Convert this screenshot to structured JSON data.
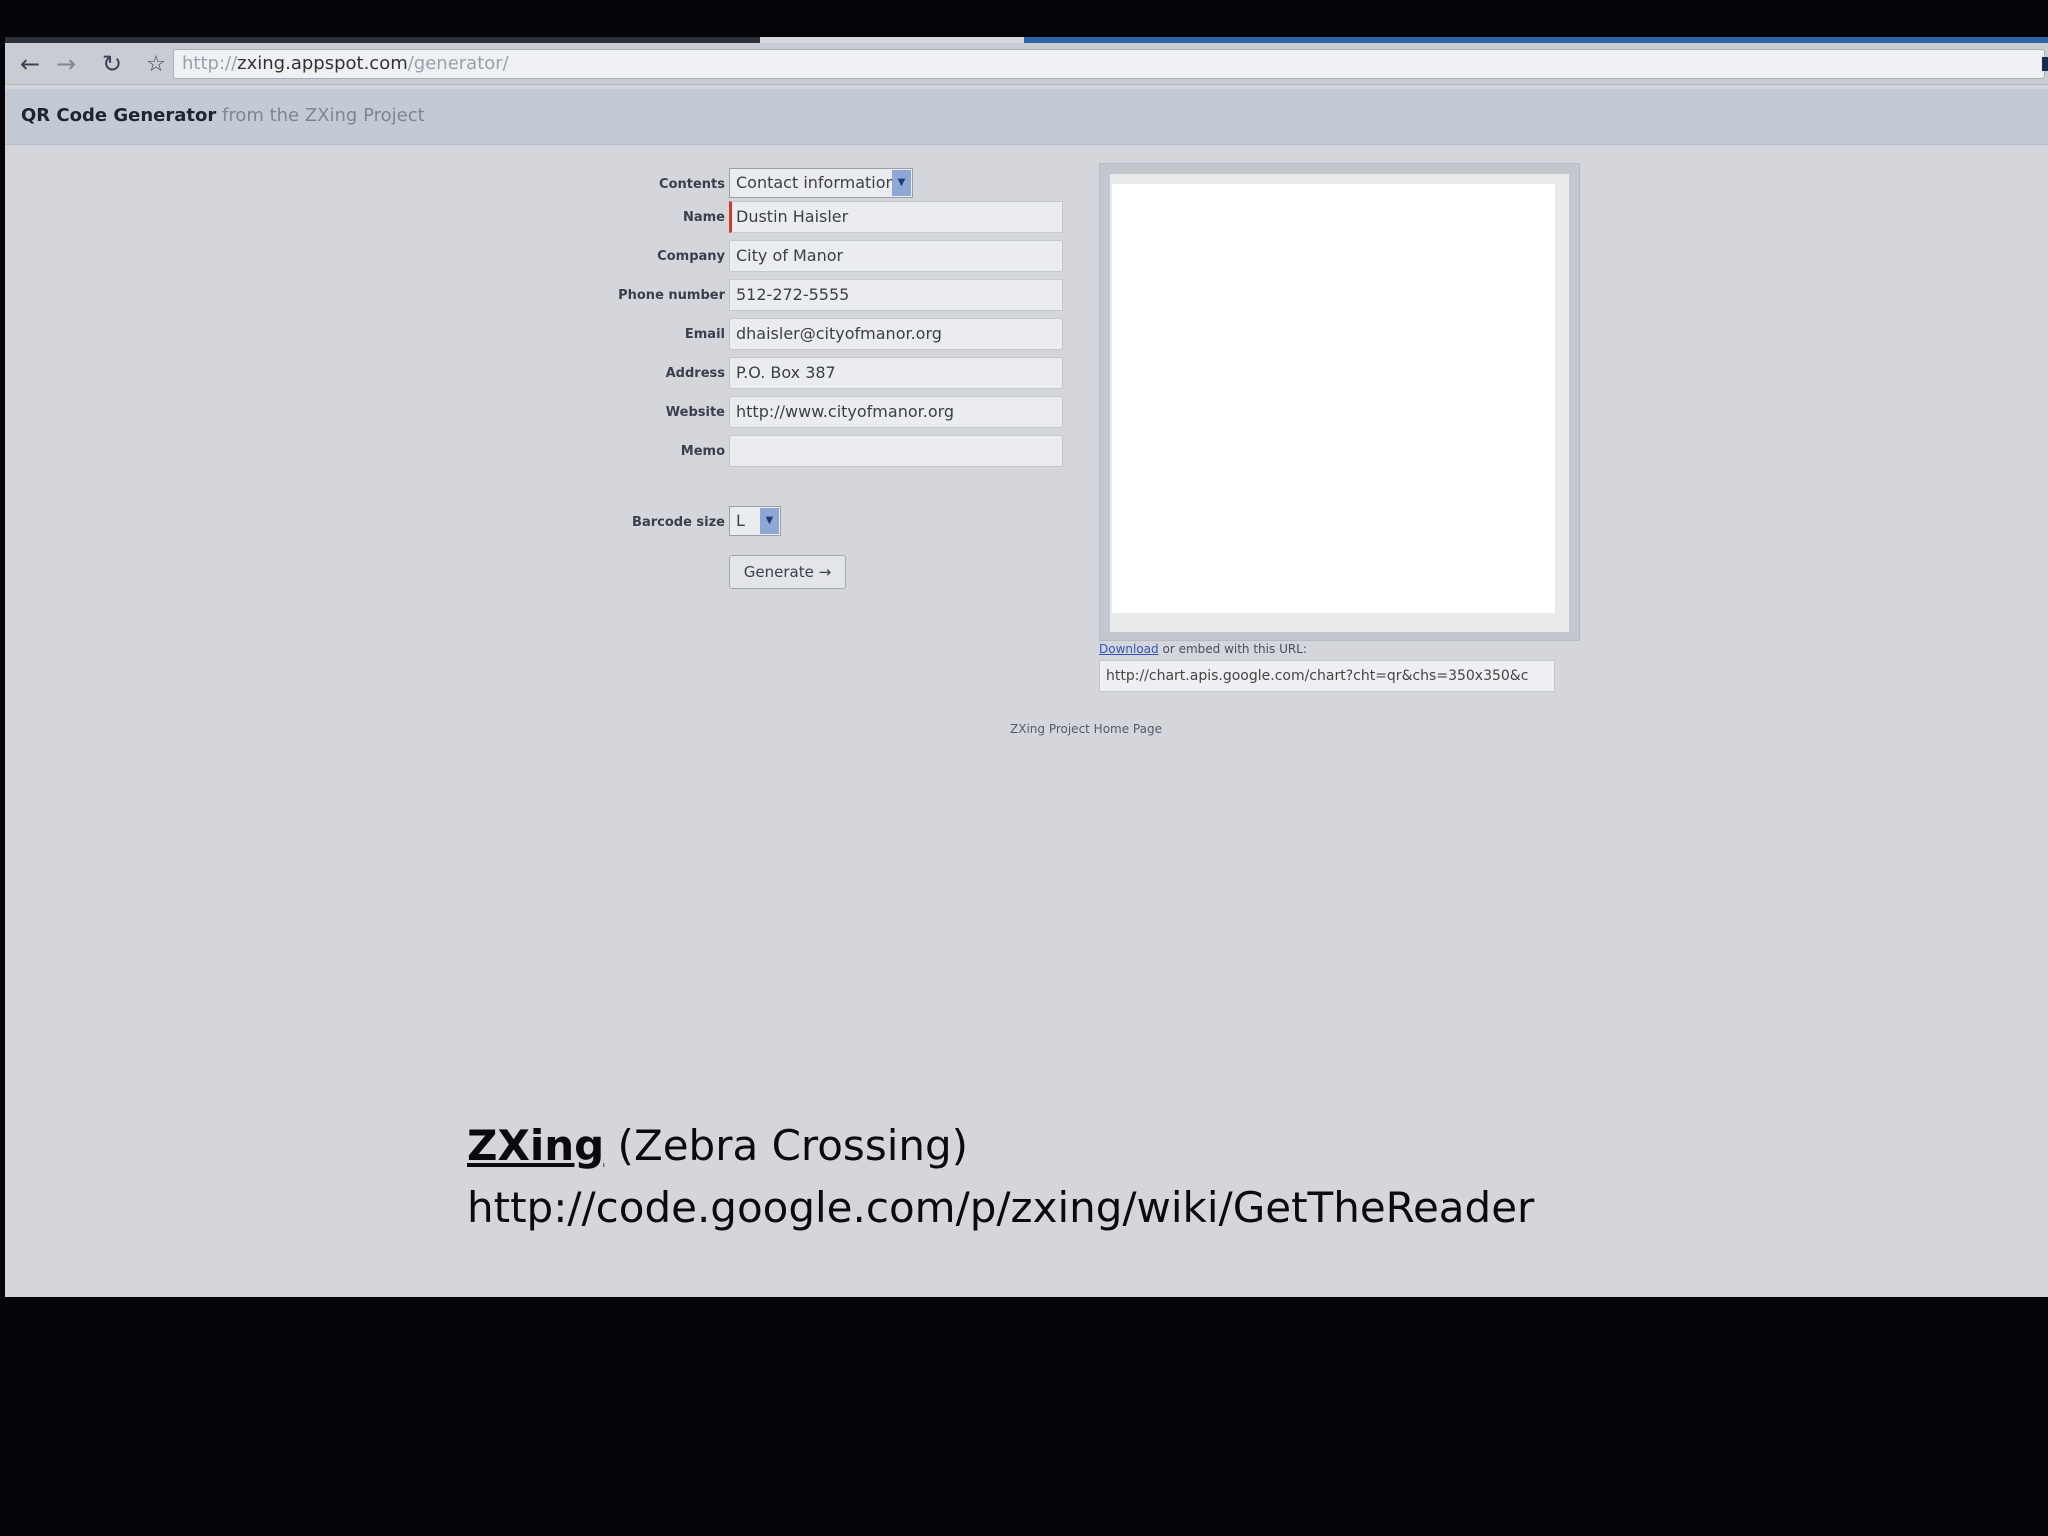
{
  "browser": {
    "url_prefix": "http://",
    "url_host": "zxing.appspot.com",
    "url_path": "/generator/",
    "icons": [
      "back-icon",
      "forward-icon",
      "reload-icon",
      "star-icon"
    ]
  },
  "header": {
    "title": "QR Code Generator",
    "subtitle": "from the ZXing Project"
  },
  "form": {
    "contents_label": "Contents",
    "contents_value": "Contact information",
    "fields": [
      {
        "label": "Name",
        "value": "Dustin Haisler"
      },
      {
        "label": "Company",
        "value": "City of Manor"
      },
      {
        "label": "Phone number",
        "value": "512-272-5555"
      },
      {
        "label": "Email",
        "value": "dhaisler@cityofmanor.org"
      },
      {
        "label": "Address",
        "value": "P.O. Box 387"
      },
      {
        "label": "Website",
        "value": "http://www.cityofmanor.org"
      },
      {
        "label": "Memo",
        "value": ""
      }
    ],
    "size_label": "Barcode size",
    "size_value": "L",
    "generate_label": "Generate →"
  },
  "preview": {
    "download_label": "Download",
    "embed_text": "or embed with this URL:",
    "embed_url": "http://chart.apis.google.com/chart?cht=qr&chs=350x350&c"
  },
  "footer": {
    "home_link": "ZXing Project Home Page"
  },
  "caption": {
    "name": "ZXing",
    "paren": " (Zebra Crossing)",
    "url": "http://code.google.com/p/zxing/wiki/GetTheReader"
  }
}
